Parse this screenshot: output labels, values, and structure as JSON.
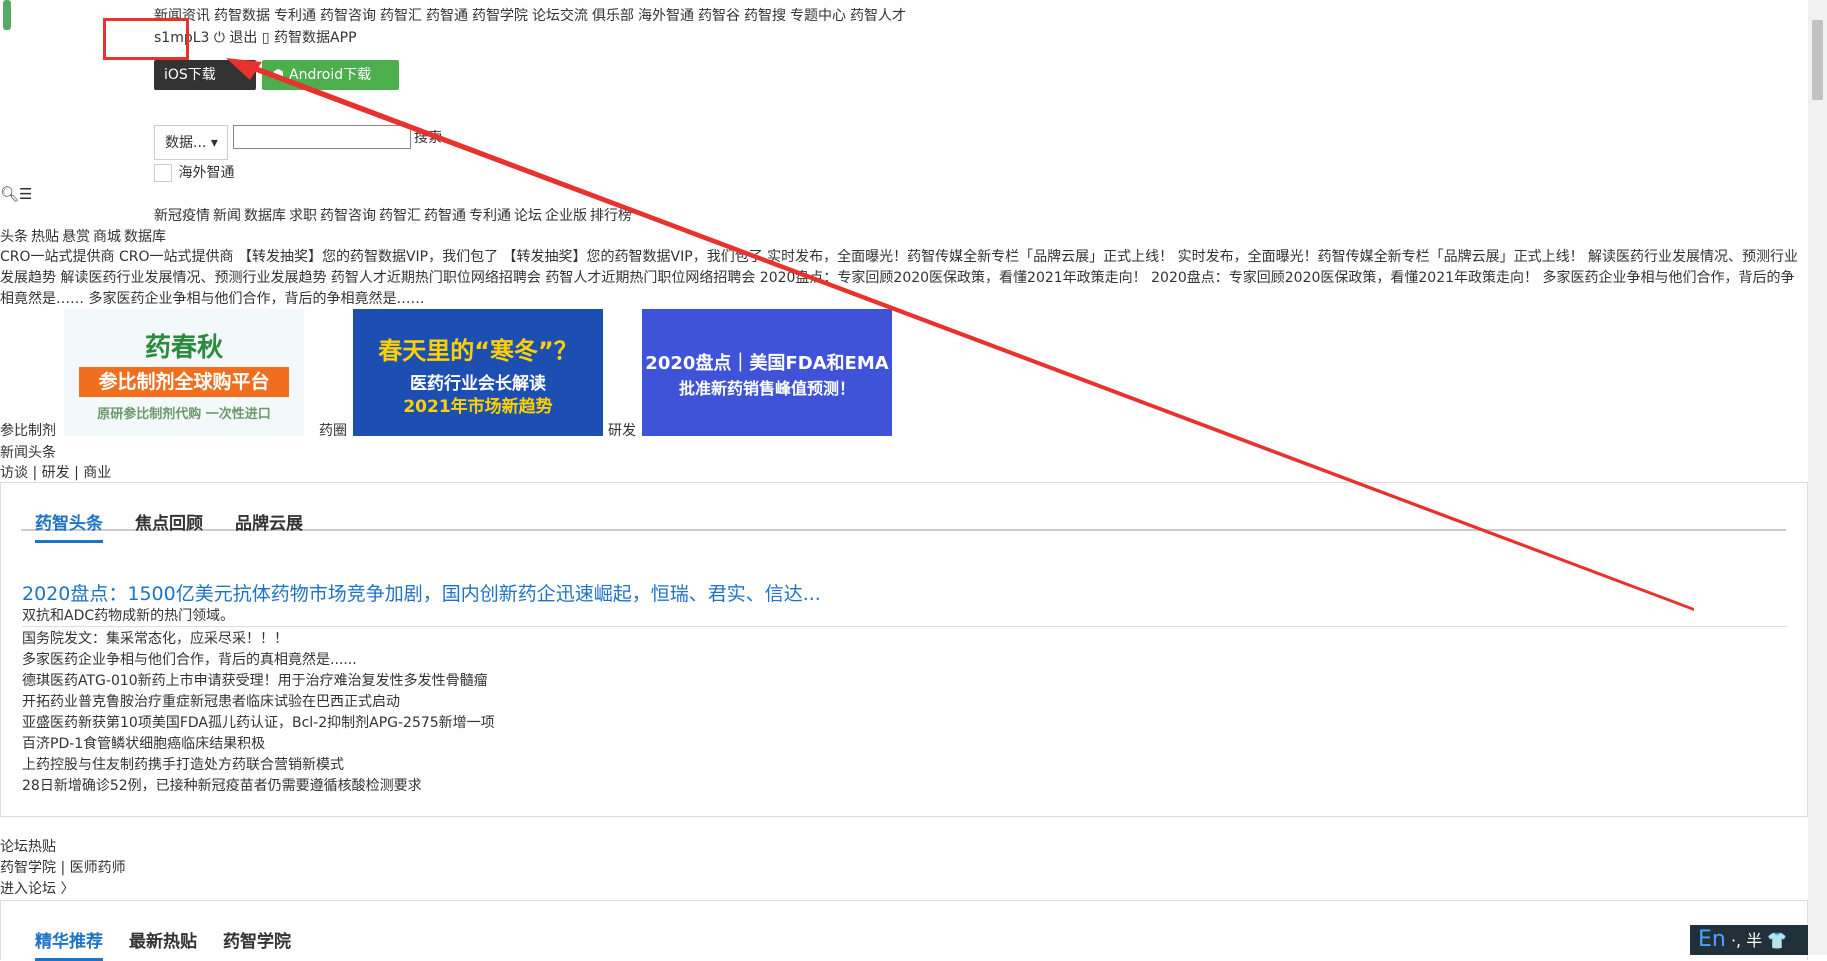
{
  "top_nav": [
    "新闻资讯",
    "药智数据",
    "专利通",
    "药智咨询",
    "药智汇",
    "药智通",
    "药智学院",
    "论坛交流",
    "俱乐部",
    "海外智通",
    "药智谷",
    "药智搜",
    "专题中心",
    "药智人才"
  ],
  "user": {
    "name": "s1mpL3",
    "logout": "退出",
    "app": "药智数据APP"
  },
  "downloads": {
    "ios": "iOS下载",
    "android": "Android下载"
  },
  "search": {
    "select_label": "数据...",
    "button": "搜索",
    "checkbox_label": "海外智通"
  },
  "main_nav": [
    "新冠疫情",
    "新闻",
    "数据库",
    "求职",
    "药智咨询",
    "药智汇",
    "药智通",
    "专利通",
    "论坛",
    "企业版",
    "排行榜"
  ],
  "sub_nav": [
    "头条",
    "热贴",
    "悬赏",
    "商城",
    "数据库"
  ],
  "ticker_text": "CRO一站式提供商 CRO一站式提供商 【转发抽奖】您的药智数据VIP，我们包了 【转发抽奖】您的药智数据VIP，我们包了 实时发布，全面曝光！药智传媒全新专栏「品牌云展」正式上线！ 实时发布，全面曝光！药智传媒全新专栏「品牌云展」正式上线！ 解读医药行业发展情况、预测行业发展趋势 解读医药行业发展情况、预测行业发展趋势 药智人才近期热门职位网络招聘会 药智人才近期热门职位网络招聘会 2020盘点：专家回顾2020医保政策，看懂2021年政策走向！ 2020盘点：专家回顾2020医保政策，看懂2021年政策走向！ 多家医药企业争相与他们合作，背后的争相竟然是…… 多家医药企业争相与他们合作，背后的争相竟然是……",
  "banners": [
    {
      "title": "药春秋",
      "subtitle": "参比制剂全球购平台",
      "footer": "原研参比制剂代购 一次性进口",
      "label": "参比制剂"
    },
    {
      "title": "春天里的“寒冬”？",
      "subtitle": "医药行业会长解读",
      "footer": "2021年市场新趋势",
      "label": "药圈"
    },
    {
      "title": "2020盘点｜美国FDA和EMA",
      "subtitle": "批准新药销售峰值预测！",
      "label": "研发"
    }
  ],
  "news_section": {
    "title": "新闻头条",
    "subnav": "访谈 | 研发 | 商业"
  },
  "news_tabs": [
    "药智头条",
    "焦点回顾",
    "品牌云展"
  ],
  "headline": {
    "title": "2020盘点：1500亿美元抗体药物市场竞争加剧，国内创新药企迅速崛起，恒瑞、君实、信达...",
    "desc": "双抗和ADC药物成新的热门领域。"
  },
  "news_items": [
    "国务院发文：集采常态化，应采尽采！！！",
    "多家医药企业争相与他们合作，背后的真相竟然是......",
    "德琪医药ATG-010新药上市申请获受理！用于治疗难治复发性多发性骨髓瘤",
    "开拓药业普克鲁胺治疗重症新冠患者临床试验在巴西正式启动",
    "亚盛医药新获第10项美国FDA孤儿药认证，Bcl-2抑制剂APG-2575新增一项",
    "百济PD-1食管鳞状细胞癌临床结果积极",
    "上药控股与住友制药携手打造处方药联合营销新模式",
    "28日新增确诊52例，已接种新冠疫苗者仍需要遵循核酸检测要求"
  ],
  "forum": {
    "title": "论坛热贴",
    "sub": "药智学院 | 医师药师",
    "enter": "进入论坛 〉"
  },
  "forum_tabs": [
    "精华推荐",
    "最新热贴",
    "药智学院"
  ],
  "ime": {
    "en": "En",
    "rest": "·, 半 👕"
  },
  "colors": {
    "accent": "#1e73c8",
    "annotation": "#e8322d",
    "android": "#4cae4c"
  }
}
